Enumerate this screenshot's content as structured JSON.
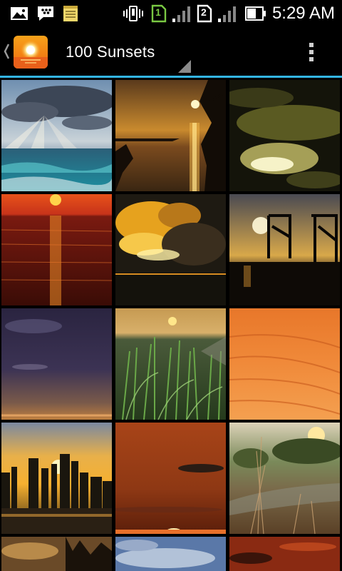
{
  "status_bar": {
    "time": "5:29 AM",
    "sim1_label": "1",
    "sim2_label": "2",
    "icons": [
      "gallery-notification-icon",
      "bbm-icon",
      "notes-icon",
      "vibrate-icon",
      "sim1-icon",
      "signal-icon",
      "sim2-icon",
      "signal-icon",
      "battery-icon"
    ]
  },
  "action_bar": {
    "title": "100 Sunsets",
    "up_icon": "chevron-left-icon",
    "app_icon": "sunset-app-icon",
    "overflow_icon": "overflow-menu-icon"
  },
  "grid": {
    "columns": 3,
    "items": [
      {
        "subject": "ocean sunbeams through clouds"
      },
      {
        "subject": "golden sunset over water with tree silhouette"
      },
      {
        "subject": "dark clouds with yellow glow"
      },
      {
        "subject": "red sun over sea"
      },
      {
        "subject": "golden sunset clouds"
      },
      {
        "subject": "harbor cranes silhouette at dusk"
      },
      {
        "subject": "purple evening sky"
      },
      {
        "subject": "grass dunes at sunset"
      },
      {
        "subject": "orange streaked sky"
      },
      {
        "subject": "city skyline at sunset"
      },
      {
        "subject": "red sky with sun on horizon"
      },
      {
        "subject": "field with grass and sunset behind trees"
      },
      {
        "subject": "dark sunset partial"
      },
      {
        "subject": "blue sky with clouds partial"
      },
      {
        "subject": "red sky partial"
      }
    ]
  },
  "colors": {
    "accent": "#33b5e5",
    "app_icon": "#f28a17"
  }
}
